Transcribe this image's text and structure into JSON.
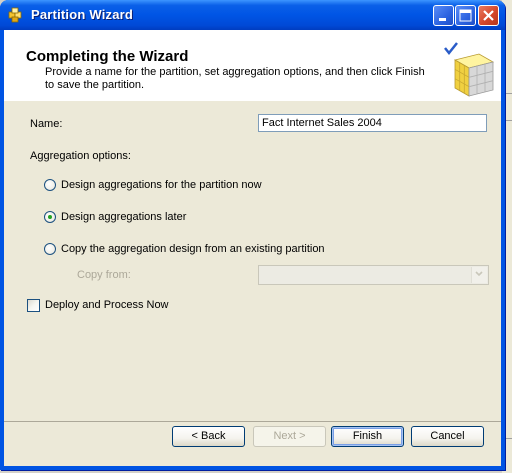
{
  "window": {
    "title": "Partition Wizard",
    "icon": "cube-icon",
    "controls": [
      "minimize-icon",
      "maximize-icon",
      "close-icon"
    ]
  },
  "header": {
    "title": "Completing the Wizard",
    "description": "Provide a name for the partition, set aggregation options, and then click Finish to save the partition.",
    "graphic": "cube-checkmark-icon"
  },
  "form": {
    "name_label": "Name:",
    "name_value": "Fact Internet Sales 2004",
    "aggregation_label": "Aggregation options:",
    "options": [
      {
        "label": "Design aggregations for the partition now",
        "selected": false
      },
      {
        "label": "Design aggregations later",
        "selected": true
      },
      {
        "label": "Copy the aggregation design from an existing partition",
        "selected": false
      }
    ],
    "copy_from_label": "Copy from:",
    "copy_from_value": "",
    "deploy_label": "Deploy and Process Now",
    "deploy_checked": false
  },
  "buttons": {
    "back": "< Back",
    "next": "Next >",
    "finish": "Finish",
    "cancel": "Cancel"
  },
  "colors": {
    "titlebar": "#0054e3",
    "dialog_bg": "#ece9d8",
    "selected_radio": "#21a121"
  }
}
